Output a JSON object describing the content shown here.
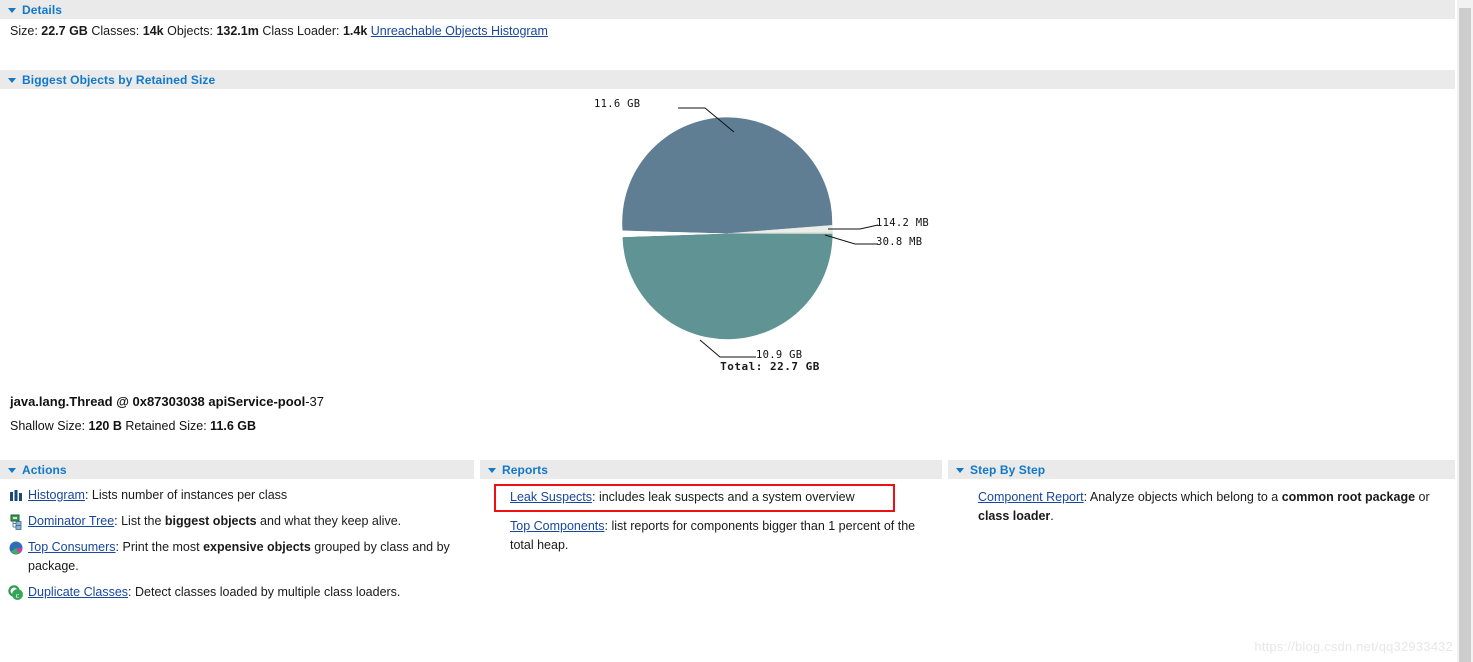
{
  "sections": {
    "details": {
      "title": "Details",
      "triangle": "triangle-down-icon"
    },
    "biggest": {
      "title": "Biggest Objects by Retained Size",
      "triangle": "triangle-down-icon"
    },
    "actions": {
      "title": "Actions",
      "triangle": "triangle-down-icon"
    },
    "reports": {
      "title": "Reports",
      "triangle": "triangle-down-icon"
    },
    "stepbystep": {
      "title": "Step By Step",
      "triangle": "triangle-down-icon"
    }
  },
  "details": {
    "size_label": "Size:",
    "size_value": "22.7 GB",
    "classes_label": "Classes:",
    "classes_value": "14k",
    "objects_label": "Objects:",
    "objects_value": "132.1m",
    "classloader_label": "Class Loader:",
    "classloader_value": "1.4k",
    "histogram_link": "Unreachable Objects Histogram"
  },
  "chart_data": {
    "type": "pie",
    "title": "Biggest Objects by Retained Size",
    "total_label": "Total: 22.7 GB",
    "total_value": 22.7,
    "total_unit": "GB",
    "labels": [
      "11.6 GB",
      "10.9 GB",
      "114.2 MB",
      "30.8 MB"
    ],
    "values": [
      11.6,
      10.9,
      0.1142,
      0.0308
    ],
    "unit": "GB",
    "colors": [
      "#5f7d93",
      "#5f9394",
      "#e8eae6",
      "#dfe3da"
    ],
    "legend": "none",
    "annotations": [
      {
        "text": "11.6 GB",
        "slice": 0
      },
      {
        "text": "10.9 GB",
        "slice": 1
      },
      {
        "text": "114.2 MB",
        "slice": 2
      },
      {
        "text": "30.8 MB",
        "slice": 3
      }
    ]
  },
  "object_summary": {
    "title_bold": "java.lang.Thread @ 0x87303038 apiService-pool",
    "title_tail": "-37",
    "shallow_label": "Shallow Size:",
    "shallow_value": "120 B",
    "retained_label": "Retained Size:",
    "retained_value": "11.6 GB"
  },
  "actions": {
    "items": [
      {
        "icon": "histogram-icon",
        "link": "Histogram",
        "sep": ": ",
        "desc_pre": "Lists number of instances per class",
        "desc_bold": "",
        "desc_post": ""
      },
      {
        "icon": "dominator-tree-icon",
        "link": "Dominator Tree",
        "sep": ": ",
        "desc_pre": "List the ",
        "desc_bold": "biggest objects",
        "desc_post": " and what they keep alive."
      },
      {
        "icon": "top-consumers-icon",
        "link": "Top Consumers",
        "sep": ": ",
        "desc_pre": "Print the most ",
        "desc_bold": "expensive objects",
        "desc_post": " grouped by class and by package."
      },
      {
        "icon": "duplicate-classes-icon",
        "link": "Duplicate Classes",
        "sep": ": ",
        "desc_pre": "Detect classes loaded by multiple class loaders.",
        "desc_bold": "",
        "desc_post": ""
      }
    ]
  },
  "reports": {
    "items": [
      {
        "link": "Leak Suspects",
        "sep": ": ",
        "desc_pre": "includes leak suspects and a system overview",
        "desc_bold": "",
        "desc_post": "",
        "highlighted": true
      },
      {
        "link": "Top Components",
        "sep": ": ",
        "desc_pre": "list reports for components bigger than 1 percent of the total heap.",
        "desc_bold": "",
        "desc_post": "",
        "highlighted": false
      }
    ]
  },
  "stepbystep": {
    "items": [
      {
        "link": "Component Report",
        "sep": ": ",
        "desc_pre": "Analyze objects which belong to a ",
        "desc_bold": "common root package",
        "desc_mid": " or ",
        "desc_bold2": "class loader",
        "desc_post": "."
      }
    ]
  },
  "watermark": {
    "text": "https://blog.csdn.net/qq32933432"
  },
  "colors": {
    "header_bg": "#eaeaea",
    "header_text": "#1278c8",
    "link": "#17479e",
    "highlight_border": "#ee1111",
    "pie_top": "#5f7d93",
    "pie_bottom": "#5f9394"
  }
}
